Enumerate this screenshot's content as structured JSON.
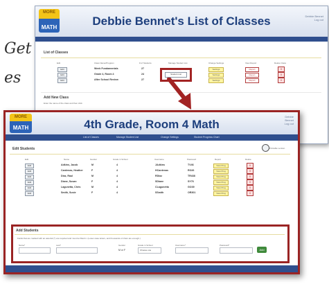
{
  "fragments": [
    "Get",
    "es"
  ],
  "back_window": {
    "logo_top": "MORE",
    "logo_bottom": "MATH",
    "title": "Debbie Bennet's List of Classes",
    "user_info": [
      "Debbie Bennet",
      "Log out"
    ],
    "list_section_title": "List of Classes",
    "columns": [
      "Edit",
      "Class Name/Program",
      "# of Students",
      "Manage Student List",
      "Change Settings",
      "View Report",
      "Delete Class"
    ],
    "rows": [
      {
        "edit": "Edit",
        "name": "Week Fundamentals",
        "students": "27",
        "manage": "",
        "settings": "Settings",
        "report": "Report",
        "delete": "X"
      },
      {
        "edit": "Edit",
        "name": "Grade 4, Room 4",
        "students": "24",
        "manage": "Student List",
        "settings": "Settings",
        "report": "Report",
        "delete": "X"
      },
      {
        "edit": "Edit",
        "name": "After School Review",
        "students": "27",
        "manage": "",
        "settings": "Settings",
        "report": "Report",
        "delete": "X"
      }
    ],
    "add_section_title": "Add New Class",
    "add_section_hint": "Enter the name of the class and then click"
  },
  "front_window": {
    "logo_top": "MORE",
    "logo_bottom": "MATH",
    "title": "4th Grade, Room 4 Math",
    "user_info": [
      "Debbie",
      "Bennet",
      "Log out"
    ],
    "nav": [
      "List of Classes",
      "Manage Student List",
      "Change Settings",
      "Student Progress Chart"
    ],
    "edit_section_title": "Edit Students",
    "print_label": "Printable version",
    "columns": [
      "Edit",
      "Name",
      "Gender",
      "Grade in School",
      "Username",
      "Password",
      "Report",
      "Delete"
    ],
    "students": [
      {
        "edit": "Edit",
        "name": "Adkins, Jacob",
        "gender": "M",
        "grade": "4",
        "username": "JAdkins",
        "password": "TV46",
        "report": "View Prog",
        "delete": "X"
      },
      {
        "edit": "Edit",
        "name": "Cardenas, Heather",
        "gender": "F",
        "grade": "4",
        "username": "HCardenas",
        "password": "RO26",
        "report": "View Prog",
        "delete": "X"
      },
      {
        "edit": "Edit",
        "name": "Diaz, Raul",
        "gender": "M",
        "grade": "4",
        "username": "RDiaz",
        "password": "TR438",
        "report": "View Prog",
        "delete": "X"
      },
      {
        "edit": "Edit",
        "name": "Diane, Susan",
        "gender": "F",
        "grade": "4",
        "username": "SDiane",
        "password": "SY76",
        "report": "View Prog",
        "delete": "X"
      },
      {
        "edit": "Edit",
        "name": "Lagunetta, Chris",
        "gender": "M",
        "grade": "4",
        "username": "CLagunetta",
        "password": "GO39",
        "report": "View Prog",
        "delete": "X"
      },
      {
        "edit": "Edit",
        "name": "Smith, Susie",
        "gender": "F",
        "grade": "4",
        "username": "SSmith",
        "password": "OR301",
        "report": "View Prog",
        "delete": "X"
      }
    ],
    "add_section_title": "Add Students",
    "add_instructions": "Fields that are marked with an asterisk (*) are required and must be filled in. (Lower-case letters, and thousands of chars are enough.)",
    "form_labels": [
      "Name*",
      "Last*",
      "Gender",
      "Grade in School",
      "Username*",
      "Password*"
    ],
    "gender_options": "M or F",
    "grade_select": "Choose one",
    "add_button": "Add"
  },
  "colors": {
    "accent": "#2f4f8e",
    "title": "#1d3f7d",
    "highlight": "#9a2424",
    "settings": "#fff6a3"
  }
}
